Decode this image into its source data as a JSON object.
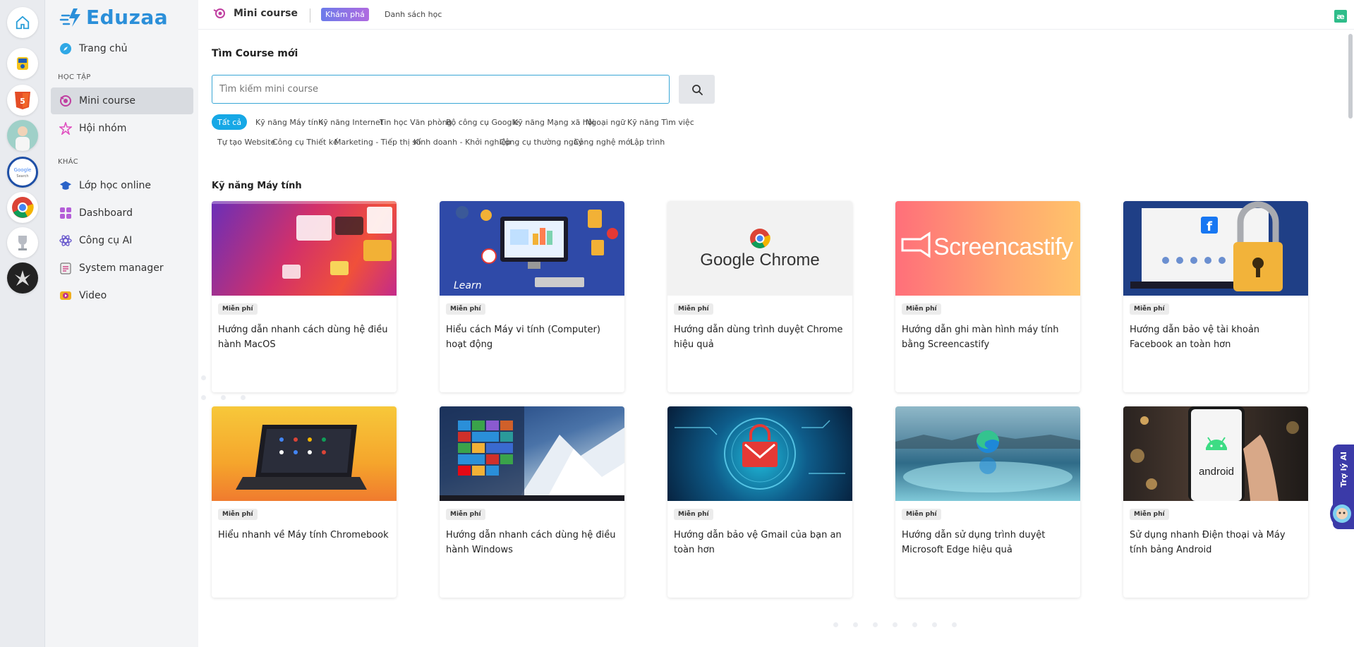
{
  "app": {
    "brand": "Eduzaa"
  },
  "sidebar": {
    "items_top": [
      {
        "label": "Trang chủ",
        "icon": "compass-icon"
      }
    ],
    "section_study": "HỌC TẬP",
    "items_study": [
      {
        "label": "Mini course",
        "icon": "mini-course-icon",
        "active": true
      },
      {
        "label": "Hội nhóm",
        "icon": "star-group-icon"
      }
    ],
    "section_other": "KHÁC",
    "items_other": [
      {
        "label": "Lớp học online",
        "icon": "graduation-cap-icon"
      },
      {
        "label": "Dashboard",
        "icon": "dashboard-icon"
      },
      {
        "label": "Công cụ AI",
        "icon": "atom-icon"
      },
      {
        "label": "System manager",
        "icon": "clipboard-icon"
      },
      {
        "label": "Video",
        "icon": "video-icon"
      }
    ]
  },
  "topbar": {
    "title": "Mini course",
    "tab_explore": "Khám phá",
    "tab_list": "Danh sách học",
    "right_logo": "æ"
  },
  "search": {
    "heading": "Tìm Course mới",
    "placeholder": "Tìm kiếm mini course"
  },
  "categories": [
    "Tất cả",
    "Kỹ năng Máy tính",
    "Kỹ năng Internet",
    "Tin học Văn phòng",
    "Bộ công cụ Google",
    "Kỹ năng Mạng xã hội",
    "Ngoại ngữ",
    "Kỹ năng Tìm việc",
    "Tự tạo Website",
    "Công cụ Thiết kế",
    "Marketing - Tiếp thị số",
    "Kinh doanh - Khởi nghiệp",
    "Công cụ thường ngày",
    "Công nghệ mới",
    "Lập trình"
  ],
  "active_category": "Tất cả",
  "section": {
    "title": "Kỹ năng Máy tính"
  },
  "courses": [
    {
      "badge": "Miễn phí",
      "title": "Hướng dẫn nhanh cách dùng hệ điều hành MacOS",
      "thumb": "macos"
    },
    {
      "badge": "Miễn phí",
      "title": "Hiểu cách Máy vi tính (Computer) hoạt động",
      "thumb": "computer"
    },
    {
      "badge": "Miễn phí",
      "title": "Hướng dẫn dùng trình duyệt Chrome hiệu quả",
      "thumb": "chrome",
      "thumb_text": "Google Chrome"
    },
    {
      "badge": "Miễn phí",
      "title": "Hướng dẫn ghi màn hình máy tính bằng Screencastify",
      "thumb": "screencastify",
      "thumb_text": "Screencastify"
    },
    {
      "badge": "Miễn phí",
      "title": "Hướng dẫn bảo vệ tài khoản Facebook an toàn hơn",
      "thumb": "facebook-lock"
    },
    {
      "badge": "Miễn phí",
      "title": "Hiểu nhanh về Máy tính Chromebook",
      "thumb": "chromebook"
    },
    {
      "badge": "Miễn phí",
      "title": "Hướng dẫn nhanh cách dùng hệ điều hành Windows",
      "thumb": "windows"
    },
    {
      "badge": "Miễn phí",
      "title": "Hướng dẫn bảo vệ Gmail của bạn an toàn hơn",
      "thumb": "gmail-lock"
    },
    {
      "badge": "Miễn phí",
      "title": "Hướng dẫn sử dụng trình duyệt Microsoft Edge hiệu quả",
      "thumb": "edge"
    },
    {
      "badge": "Miễn phí",
      "title": "Sử dụng nhanh Điện thoại và Máy tính bảng Android",
      "thumb": "android",
      "thumb_text": "android"
    }
  ],
  "ai_assistant": {
    "label": "Trợ lý AI"
  },
  "colors": {
    "accent": "#16a8e6",
    "brand": "#2b8fd9",
    "search_border": "#3aa7d6"
  }
}
